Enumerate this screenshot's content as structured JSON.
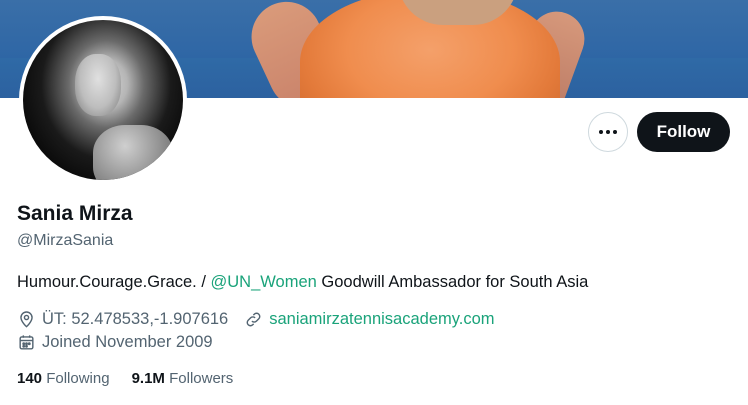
{
  "profile": {
    "name": "Sania Mirza",
    "handle": "@MirzaSania",
    "bio_pre": "Humour.Courage.Grace. / ",
    "bio_mention": "@UN_Women",
    "bio_post": " Goodwill Ambassador for South Asia",
    "location": "ÜT: 52.478533,-1.907616",
    "website": "saniamirzatennisacademy.com",
    "joined": "Joined November 2009"
  },
  "actions": {
    "follow_label": "Follow",
    "more_icon": "more-horizontal-icon"
  },
  "stats": {
    "following_count": "140",
    "following_label": "Following",
    "followers_count": "9.1M",
    "followers_label": "Followers"
  },
  "colors": {
    "accent": "#1aa37a",
    "primary_text": "#0f1419",
    "secondary_text": "#536471",
    "follow_button_bg": "#0f1419"
  }
}
